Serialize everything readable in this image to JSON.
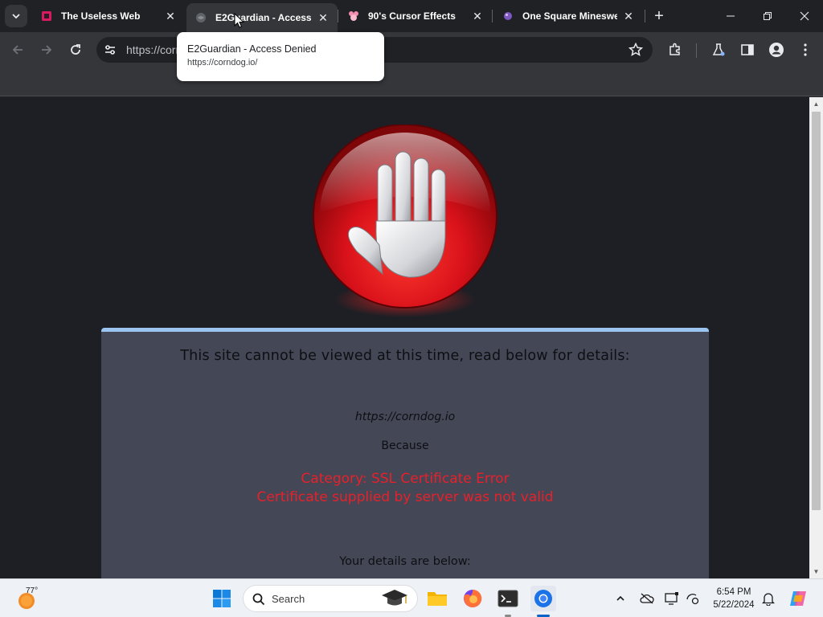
{
  "browser": {
    "tabs": [
      {
        "title": "The Useless Web",
        "favicon": "useless-web-favicon",
        "active": false
      },
      {
        "title": "E2Guardian - Access Denied",
        "favicon": "globe-favicon",
        "active": true
      },
      {
        "title": "90's Cursor Effects",
        "favicon": "mouse-favicon",
        "active": false
      },
      {
        "title": "One Square Minesweeper",
        "favicon": "minesweeper-favicon",
        "active": false
      }
    ],
    "address_bar": {
      "url": "https://corndog.io/"
    },
    "hover_card": {
      "title": "E2Guardian - Access Denied",
      "url": "https://corndog.io/"
    }
  },
  "page": {
    "headline": "This site cannot be viewed at this time, read below for details:",
    "blocked_url": "https://corndog.io",
    "because_label": "Because",
    "reason_category": "Category: SSL Certificate Error",
    "reason_detail": "Certificate supplied by server was not valid",
    "details_heading": "Your details are below:"
  },
  "taskbar": {
    "weather_temp": "77°",
    "search_placeholder": "Search",
    "clock_time": "6:54 PM",
    "clock_date": "5/22/2024"
  },
  "colors": {
    "panel_bg": "#444756",
    "panel_accent": "#9bc4f0",
    "reason_red": "#e8202a",
    "page_bg": "#1d1f24",
    "chrome_dark": "#202124",
    "chrome_toolbar": "#35363a"
  }
}
